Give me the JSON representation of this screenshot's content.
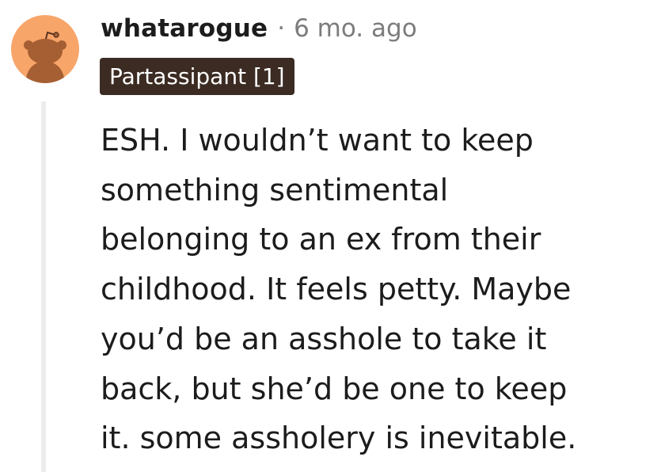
{
  "comment": {
    "author": "whatarogue",
    "separator": "·",
    "timestamp": "6 mo. ago",
    "flair": "Partassipant [1]",
    "body_lines": [
      "ESH. I wouldn’t want to keep",
      "something sentimental",
      "belonging to an ex from their",
      "childhood. It feels petty. Maybe",
      "you’d be an asshole to take it",
      "back, but she’d be one to keep",
      "it. some assholery is inevitable."
    ]
  },
  "avatar": {
    "icon": "snoo-avatar-icon",
    "background_color": "#f8a56a",
    "figure_color": "#a65f33"
  },
  "colors": {
    "flair_background": "#3b2b22",
    "flair_text": "#ffffff",
    "username": "#1c1c1c",
    "meta": "#7c7c7c",
    "thread_line": "#ececec"
  }
}
